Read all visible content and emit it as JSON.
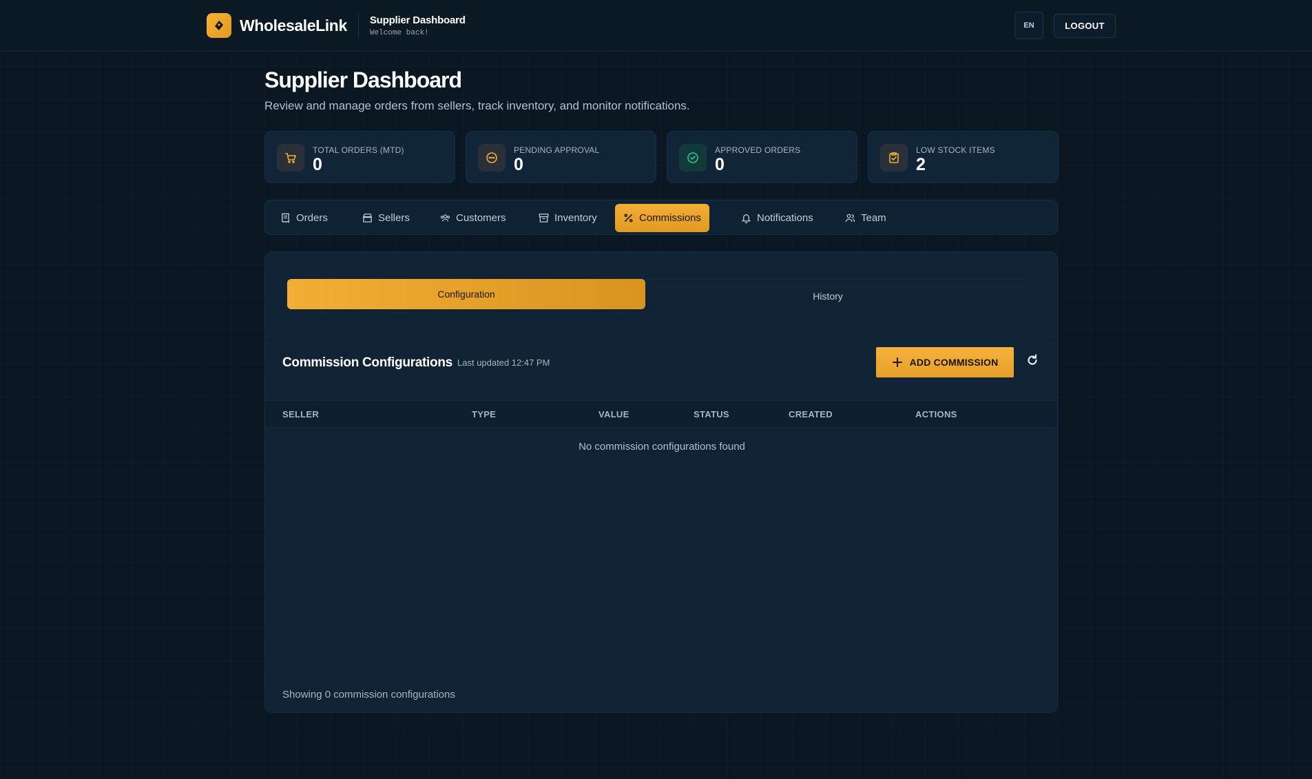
{
  "header": {
    "brand_name": "WholesaleLink",
    "subtitle": "Supplier Dashboard",
    "welcome": "Welcome back!",
    "lang_label": "EN",
    "logout_label": "LOGOUT"
  },
  "page": {
    "title": "Supplier Dashboard",
    "subtitle": "Review and manage orders from sellers, track inventory, and monitor notifications."
  },
  "stats": [
    {
      "label": "TOTAL ORDERS (MTD)",
      "value": "0",
      "icon": "cart-icon"
    },
    {
      "label": "PENDING APPROVAL",
      "value": "0",
      "icon": "pending-icon"
    },
    {
      "label": "APPROVED ORDERS",
      "value": "0",
      "icon": "check-circle-icon"
    },
    {
      "label": "LOW STOCK ITEMS",
      "value": "2",
      "icon": "clipboard-check-icon"
    }
  ],
  "tabs": [
    {
      "label": "Orders",
      "icon": "receipt-icon",
      "active": false
    },
    {
      "label": "Sellers",
      "icon": "store-icon",
      "active": false
    },
    {
      "label": "Customers",
      "icon": "users-icon",
      "active": false
    },
    {
      "label": "Inventory",
      "icon": "archive-icon",
      "active": false
    },
    {
      "label": "Commissions",
      "icon": "percent-icon",
      "active": true
    },
    {
      "label": "Notifications",
      "icon": "bell-icon",
      "active": false
    },
    {
      "label": "Team",
      "icon": "team-icon",
      "active": false
    }
  ],
  "subtabs": {
    "configuration": "Configuration",
    "history": "History"
  },
  "commissions": {
    "title": "Commission Configurations",
    "last_updated": "Last updated 12:47 PM",
    "add_label": "ADD COMMISSION",
    "columns": [
      "SELLER",
      "TYPE",
      "VALUE",
      "STATUS",
      "CREATED",
      "ACTIONS"
    ],
    "rows": [],
    "empty_message": "No commission configurations found",
    "footer": "Showing 0 commission configurations"
  },
  "colors": {
    "accent": "#f3ae35",
    "background": "#0a1622",
    "panel": "#0f2335",
    "success": "#2fc48d"
  }
}
